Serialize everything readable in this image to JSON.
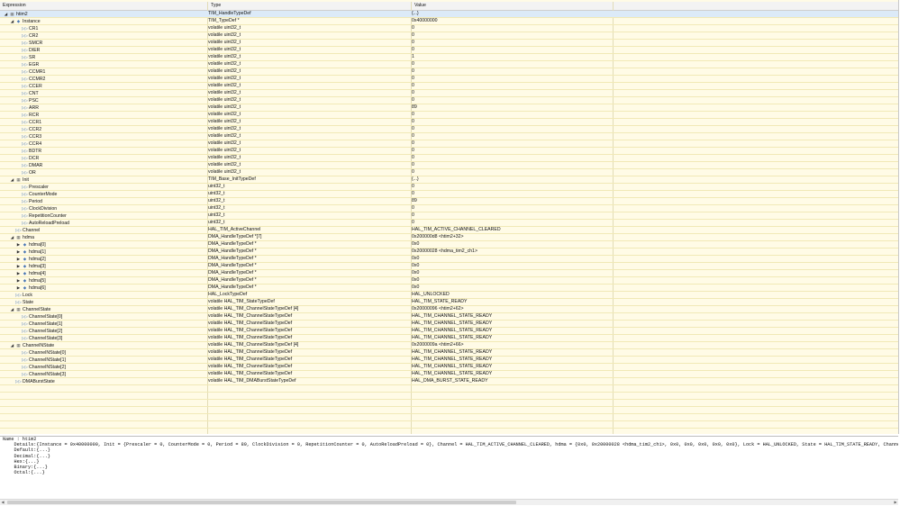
{
  "columns": {
    "expression": "Expression",
    "type": "Type",
    "value": "Value"
  },
  "rows": [
    {
      "lvl": 0,
      "tw": "▲",
      "icon": "struct",
      "expr": "htim2",
      "type": "TIM_HandleTypeDef",
      "value": "{...}",
      "sel": true
    },
    {
      "lvl": 1,
      "tw": "▲",
      "icon": "pointer",
      "expr": "Instance",
      "type": "TIM_TypeDef *",
      "value": "0x40000000"
    },
    {
      "lvl": 2,
      "tw": "",
      "icon": "field",
      "expr": "CR1",
      "type": "volatile uint32_t",
      "value": "0"
    },
    {
      "lvl": 2,
      "tw": "",
      "icon": "field",
      "expr": "CR2",
      "type": "volatile uint32_t",
      "value": "0"
    },
    {
      "lvl": 2,
      "tw": "",
      "icon": "field",
      "expr": "SMCR",
      "type": "volatile uint32_t",
      "value": "0"
    },
    {
      "lvl": 2,
      "tw": "",
      "icon": "field",
      "expr": "DIER",
      "type": "volatile uint32_t",
      "value": "0"
    },
    {
      "lvl": 2,
      "tw": "",
      "icon": "field",
      "expr": "SR",
      "type": "volatile uint32_t",
      "value": "1"
    },
    {
      "lvl": 2,
      "tw": "",
      "icon": "field",
      "expr": "EGR",
      "type": "volatile uint32_t",
      "value": "0"
    },
    {
      "lvl": 2,
      "tw": "",
      "icon": "field",
      "expr": "CCMR1",
      "type": "volatile uint32_t",
      "value": "0"
    },
    {
      "lvl": 2,
      "tw": "",
      "icon": "field",
      "expr": "CCMR2",
      "type": "volatile uint32_t",
      "value": "0"
    },
    {
      "lvl": 2,
      "tw": "",
      "icon": "field",
      "expr": "CCER",
      "type": "volatile uint32_t",
      "value": "0"
    },
    {
      "lvl": 2,
      "tw": "",
      "icon": "field",
      "expr": "CNT",
      "type": "volatile uint32_t",
      "value": "0"
    },
    {
      "lvl": 2,
      "tw": "",
      "icon": "field",
      "expr": "PSC",
      "type": "volatile uint32_t",
      "value": "0"
    },
    {
      "lvl": 2,
      "tw": "",
      "icon": "field",
      "expr": "ARR",
      "type": "volatile uint32_t",
      "value": "89"
    },
    {
      "lvl": 2,
      "tw": "",
      "icon": "field",
      "expr": "RCR",
      "type": "volatile uint32_t",
      "value": "0"
    },
    {
      "lvl": 2,
      "tw": "",
      "icon": "field",
      "expr": "CCR1",
      "type": "volatile uint32_t",
      "value": "0"
    },
    {
      "lvl": 2,
      "tw": "",
      "icon": "field",
      "expr": "CCR2",
      "type": "volatile uint32_t",
      "value": "0"
    },
    {
      "lvl": 2,
      "tw": "",
      "icon": "field",
      "expr": "CCR3",
      "type": "volatile uint32_t",
      "value": "0"
    },
    {
      "lvl": 2,
      "tw": "",
      "icon": "field",
      "expr": "CCR4",
      "type": "volatile uint32_t",
      "value": "0"
    },
    {
      "lvl": 2,
      "tw": "",
      "icon": "field",
      "expr": "BDTR",
      "type": "volatile uint32_t",
      "value": "0"
    },
    {
      "lvl": 2,
      "tw": "",
      "icon": "field",
      "expr": "DCR",
      "type": "volatile uint32_t",
      "value": "0"
    },
    {
      "lvl": 2,
      "tw": "",
      "icon": "field",
      "expr": "DMAR",
      "type": "volatile uint32_t",
      "value": "0"
    },
    {
      "lvl": 2,
      "tw": "",
      "icon": "field",
      "expr": "OR",
      "type": "volatile uint32_t",
      "value": "0"
    },
    {
      "lvl": 1,
      "tw": "▲",
      "icon": "struct",
      "expr": "Init",
      "type": "TIM_Base_InitTypeDef",
      "value": "{...}"
    },
    {
      "lvl": 2,
      "tw": "",
      "icon": "field",
      "expr": "Prescaler",
      "type": "uint32_t",
      "value": "0"
    },
    {
      "lvl": 2,
      "tw": "",
      "icon": "field",
      "expr": "CounterMode",
      "type": "uint32_t",
      "value": "0"
    },
    {
      "lvl": 2,
      "tw": "",
      "icon": "field",
      "expr": "Period",
      "type": "uint32_t",
      "value": "89"
    },
    {
      "lvl": 2,
      "tw": "",
      "icon": "field",
      "expr": "ClockDivision",
      "type": "uint32_t",
      "value": "0"
    },
    {
      "lvl": 2,
      "tw": "",
      "icon": "field",
      "expr": "RepetitionCounter",
      "type": "uint32_t",
      "value": "0"
    },
    {
      "lvl": 2,
      "tw": "",
      "icon": "field",
      "expr": "AutoReloadPreload",
      "type": "uint32_t",
      "value": "0"
    },
    {
      "lvl": 1,
      "tw": "",
      "icon": "field",
      "expr": "Channel",
      "type": "HAL_TIM_ActiveChannel",
      "value": "HAL_TIM_ACTIVE_CHANNEL_CLEARED"
    },
    {
      "lvl": 1,
      "tw": "▲",
      "icon": "struct",
      "expr": "hdma",
      "type": "DMA_HandleTypeDef *[7]",
      "value": "0x200000d8 <htim2+32>"
    },
    {
      "lvl": 2,
      "tw": "▶",
      "icon": "pointer",
      "expr": "hdma[0]",
      "type": "DMA_HandleTypeDef *",
      "value": "0x0"
    },
    {
      "lvl": 2,
      "tw": "▶",
      "icon": "pointer",
      "expr": "hdma[1]",
      "type": "DMA_HandleTypeDef *",
      "value": "0x20000028 <hdma_tim2_ch1>"
    },
    {
      "lvl": 2,
      "tw": "▶",
      "icon": "pointer",
      "expr": "hdma[2]",
      "type": "DMA_HandleTypeDef *",
      "value": "0x0"
    },
    {
      "lvl": 2,
      "tw": "▶",
      "icon": "pointer",
      "expr": "hdma[3]",
      "type": "DMA_HandleTypeDef *",
      "value": "0x0"
    },
    {
      "lvl": 2,
      "tw": "▶",
      "icon": "pointer",
      "expr": "hdma[4]",
      "type": "DMA_HandleTypeDef *",
      "value": "0x0"
    },
    {
      "lvl": 2,
      "tw": "▶",
      "icon": "pointer",
      "expr": "hdma[5]",
      "type": "DMA_HandleTypeDef *",
      "value": "0x0"
    },
    {
      "lvl": 2,
      "tw": "▶",
      "icon": "pointer",
      "expr": "hdma[6]",
      "type": "DMA_HandleTypeDef *",
      "value": "0x0"
    },
    {
      "lvl": 1,
      "tw": "",
      "icon": "field",
      "expr": "Lock",
      "type": "HAL_LockTypeDef",
      "value": "HAL_UNLOCKED"
    },
    {
      "lvl": 1,
      "tw": "",
      "icon": "field",
      "expr": "State",
      "type": "volatile HAL_TIM_StateTypeDef",
      "value": "HAL_TIM_STATE_READY"
    },
    {
      "lvl": 1,
      "tw": "▲",
      "icon": "struct",
      "expr": "ChannelState",
      "type": "volatile HAL_TIM_ChannelStateTypeDef [4]",
      "value": "0x20000096 <htim2+62>"
    },
    {
      "lvl": 2,
      "tw": "",
      "icon": "field",
      "expr": "ChannelState[0]",
      "type": "volatile HAL_TIM_ChannelStateTypeDef",
      "value": "HAL_TIM_CHANNEL_STATE_READY"
    },
    {
      "lvl": 2,
      "tw": "",
      "icon": "field",
      "expr": "ChannelState[1]",
      "type": "volatile HAL_TIM_ChannelStateTypeDef",
      "value": "HAL_TIM_CHANNEL_STATE_READY"
    },
    {
      "lvl": 2,
      "tw": "",
      "icon": "field",
      "expr": "ChannelState[2]",
      "type": "volatile HAL_TIM_ChannelStateTypeDef",
      "value": "HAL_TIM_CHANNEL_STATE_READY"
    },
    {
      "lvl": 2,
      "tw": "",
      "icon": "field",
      "expr": "ChannelState[3]",
      "type": "volatile HAL_TIM_ChannelStateTypeDef",
      "value": "HAL_TIM_CHANNEL_STATE_READY"
    },
    {
      "lvl": 1,
      "tw": "▲",
      "icon": "struct",
      "expr": "ChannelNState",
      "type": "volatile HAL_TIM_ChannelStateTypeDef [4]",
      "value": "0x2000009a <htim2+66>"
    },
    {
      "lvl": 2,
      "tw": "",
      "icon": "field",
      "expr": "ChannelNState[0]",
      "type": "volatile HAL_TIM_ChannelStateTypeDef",
      "value": "HAL_TIM_CHANNEL_STATE_READY"
    },
    {
      "lvl": 2,
      "tw": "",
      "icon": "field",
      "expr": "ChannelNState[1]",
      "type": "volatile HAL_TIM_ChannelStateTypeDef",
      "value": "HAL_TIM_CHANNEL_STATE_READY"
    },
    {
      "lvl": 2,
      "tw": "",
      "icon": "field",
      "expr": "ChannelNState[2]",
      "type": "volatile HAL_TIM_ChannelStateTypeDef",
      "value": "HAL_TIM_CHANNEL_STATE_READY"
    },
    {
      "lvl": 2,
      "tw": "",
      "icon": "field",
      "expr": "ChannelNState[3]",
      "type": "volatile HAL_TIM_ChannelStateTypeDef",
      "value": "HAL_TIM_CHANNEL_STATE_READY"
    },
    {
      "lvl": 1,
      "tw": "",
      "icon": "field",
      "expr": "DMABurstState",
      "type": "volatile HAL_TIM_DMABurstStateTypeDef",
      "value": "HAL_DMA_BURST_STATE_READY"
    }
  ],
  "details": {
    "name_line": "Name : htim2",
    "details_line": "    Details:{Instance = 0x40000000, Init = {Prescaler = 0, CounterMode = 0, Period = 89, ClockDivision = 0, RepetitionCounter = 0, AutoReloadPreload = 0}, Channel = HAL_TIM_ACTIVE_CHANNEL_CLEARED, hdma = {0x0, 0x20000028 <hdma_tim2_ch1>, 0x0, 0x0, 0x0, 0x0, 0x0}, Lock = HAL_UNLOCKED, State = HAL_TIM_STATE_READY, ChannelState = {HAL_TIM_CHANNEL_STATE_READY, HA",
    "default_line": "    Default:{...}",
    "decimal_line": "    Decimal:{...}",
    "hex_line": "    Hex:{...}",
    "binary_line": "    Binary:{...}",
    "octal_line": "    Octal:{...}"
  },
  "icons": {
    "struct": "▦",
    "pointer": "◆",
    "field": "▷▷"
  }
}
